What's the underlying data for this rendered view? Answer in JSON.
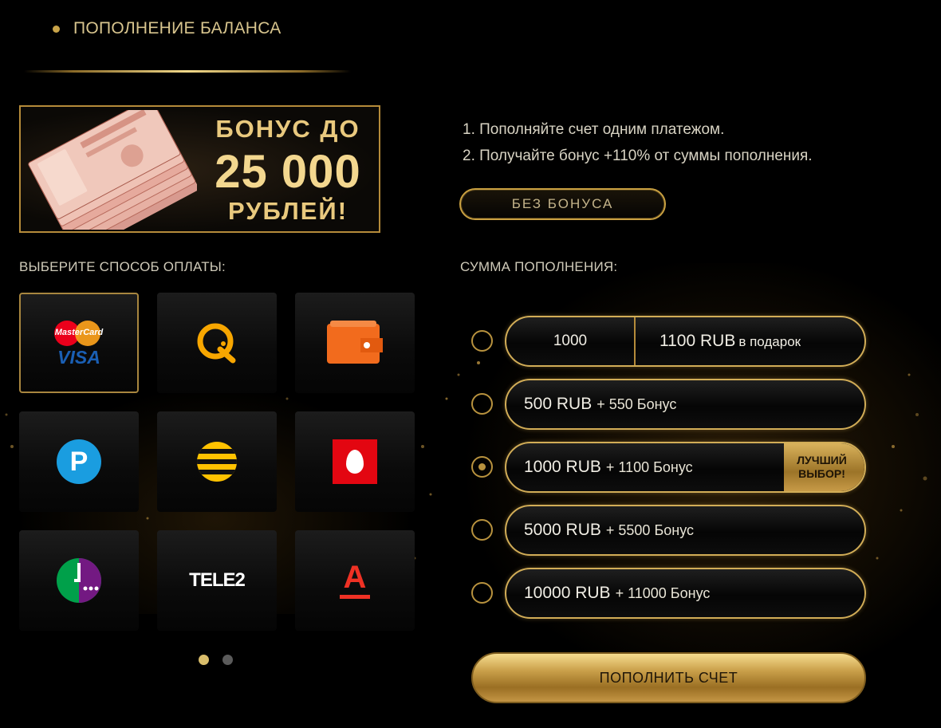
{
  "header": {
    "title": "ПОПОЛНЕНИЕ БАЛАНСА"
  },
  "banner": {
    "line1": "БОНУС ДО",
    "line2": "25 000",
    "line3": "РУБЛЕЙ!"
  },
  "steps": [
    "1. Пополняйте счет одним платежом.",
    "2. Получайте бонус +110% от суммы пополнения."
  ],
  "no_bonus_label": "БЕЗ БОНУСА",
  "payment": {
    "label": "ВЫБЕРИТЕ СПОСОБ ОПЛАТЫ:",
    "methods": [
      {
        "id": "mastercard-visa",
        "icon": "mastercard-visa-icon",
        "mc_text": "MasterCard",
        "visa_text": "VISA",
        "selected": true
      },
      {
        "id": "qiwi",
        "icon": "qiwi-icon",
        "selected": false
      },
      {
        "id": "wallet",
        "icon": "wallet-icon",
        "selected": false
      },
      {
        "id": "parking",
        "icon": "parking-p-icon",
        "letter": "P",
        "selected": false
      },
      {
        "id": "beeline",
        "icon": "beeline-icon",
        "selected": false
      },
      {
        "id": "mts",
        "icon": "mts-egg-icon",
        "selected": false
      },
      {
        "id": "megafon",
        "icon": "megafon-icon",
        "selected": false
      },
      {
        "id": "tele2",
        "icon": "tele2-icon",
        "text": "TELE2",
        "selected": false
      },
      {
        "id": "alfa",
        "icon": "alfa-bank-icon",
        "letter": "А",
        "selected": false
      }
    ],
    "pages": 2,
    "current_page": 1
  },
  "amount": {
    "label": "СУММА ПОПОЛНЕНИЯ:",
    "custom": {
      "value": "1000",
      "gift_amount": "1100 RUB",
      "gift_suffix": "в подарок"
    },
    "options": [
      {
        "main": "500 RUB",
        "bonus": "+ 550 Бонус",
        "checked": false
      },
      {
        "main": "1000 RUB",
        "bonus": "+ 1100 Бонус",
        "checked": true,
        "tag": "ЛУЧШИЙ ВЫБОР!"
      },
      {
        "main": "5000 RUB",
        "bonus": "+ 5500 Бонус",
        "checked": false
      },
      {
        "main": "10000 RUB",
        "bonus": "+ 11000 Бонус",
        "checked": false
      }
    ]
  },
  "submit_label": "ПОПОЛНИТЬ СЧЕТ",
  "colors": {
    "gold": "#c9a449",
    "background": "#000000",
    "qiwi": "#f7a600",
    "wallet": "#f26b1d",
    "parking": "#1a9de0",
    "mts": "#e30611",
    "megafon": "#00a04a",
    "alfa": "#ef3124"
  }
}
